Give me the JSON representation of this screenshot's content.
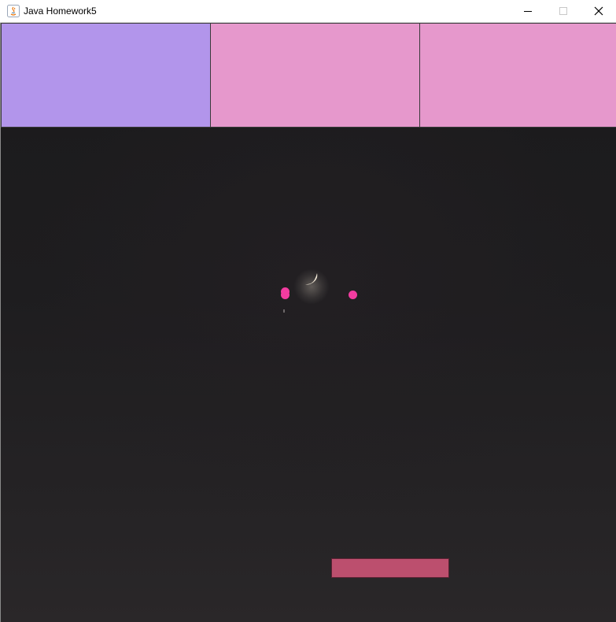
{
  "window": {
    "title": "Java Homework5",
    "app_icon": "java-icon",
    "controls": {
      "minimize_icon": "minimize-icon",
      "maximize_icon": "maximize-icon",
      "close_icon": "close-icon"
    }
  },
  "game": {
    "bricks": [
      {
        "color": "#b295eb"
      },
      {
        "color": "#e698cc"
      },
      {
        "color": "#e698cc"
      }
    ],
    "balls": [
      {
        "color": "#f23ca0"
      },
      {
        "color": "#f23ca0"
      },
      {
        "color": "#f23ca0"
      }
    ],
    "paddle": {
      "color": "#bc4f6e"
    },
    "background": {
      "icon": "crescent-moon-icon"
    }
  }
}
